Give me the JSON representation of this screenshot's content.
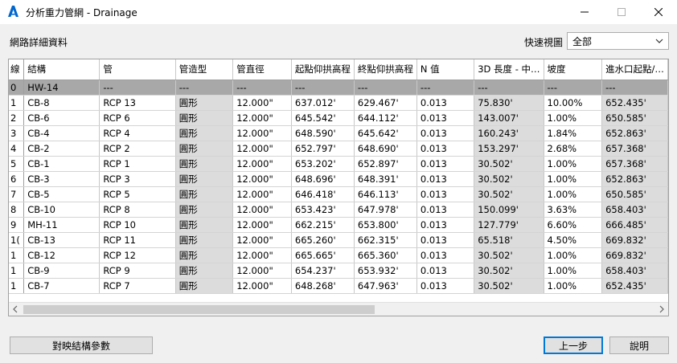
{
  "window": {
    "title": "分析重力管網 - Drainage"
  },
  "section_label": "網路詳細資料",
  "quick_view": {
    "label": "快速視圖",
    "value": "全部"
  },
  "columns": [
    "線",
    "結構",
    "管",
    "管造型",
    "管直徑",
    "起點仰拱高程",
    "終點仰拱高程",
    "N 值",
    "3D 長度 - 中…",
    "坡度",
    "進水口起點/…"
  ],
  "rows": [
    [
      "0",
      "HW-14",
      "---",
      "---",
      "---",
      "---",
      "---",
      "---",
      "---",
      "---",
      "---"
    ],
    [
      "1",
      "CB-8",
      "RCP 13",
      "圓形",
      "12.000\"",
      "637.012'",
      "629.467'",
      "0.013",
      "75.830'",
      "10.00%",
      "652.435'"
    ],
    [
      "2",
      "CB-6",
      "RCP 6",
      "圓形",
      "12.000\"",
      "645.542'",
      "644.112'",
      "0.013",
      "143.007'",
      "1.00%",
      "650.585'"
    ],
    [
      "3",
      "CB-4",
      "RCP 4",
      "圓形",
      "12.000\"",
      "648.590'",
      "645.642'",
      "0.013",
      "160.243'",
      "1.84%",
      "652.863'"
    ],
    [
      "4",
      "CB-2",
      "RCP 2",
      "圓形",
      "12.000\"",
      "652.797'",
      "648.690'",
      "0.013",
      "153.297'",
      "2.68%",
      "657.368'"
    ],
    [
      "5",
      "CB-1",
      "RCP 1",
      "圓形",
      "12.000\"",
      "653.202'",
      "652.897'",
      "0.013",
      "30.502'",
      "1.00%",
      "657.368'"
    ],
    [
      "6",
      "CB-3",
      "RCP 3",
      "圓形",
      "12.000\"",
      "648.696'",
      "648.391'",
      "0.013",
      "30.502'",
      "1.00%",
      "652.863'"
    ],
    [
      "7",
      "CB-5",
      "RCP 5",
      "圓形",
      "12.000\"",
      "646.418'",
      "646.113'",
      "0.013",
      "30.502'",
      "1.00%",
      "650.585'"
    ],
    [
      "8",
      "CB-10",
      "RCP 8",
      "圓形",
      "12.000\"",
      "653.423'",
      "647.978'",
      "0.013",
      "150.099'",
      "3.63%",
      "658.403'"
    ],
    [
      "9",
      "MH-11",
      "RCP 10",
      "圓形",
      "12.000\"",
      "662.215'",
      "653.800'",
      "0.013",
      "127.779'",
      "6.60%",
      "666.485'"
    ],
    [
      "1(",
      "CB-13",
      "RCP 11",
      "圓形",
      "12.000\"",
      "665.260'",
      "662.315'",
      "0.013",
      "65.518'",
      "4.50%",
      "669.832'"
    ],
    [
      "1",
      "CB-12",
      "RCP 12",
      "圓形",
      "12.000\"",
      "665.665'",
      "665.360'",
      "0.013",
      "30.502'",
      "1.00%",
      "669.832'"
    ],
    [
      "1",
      "CB-9",
      "RCP 9",
      "圓形",
      "12.000\"",
      "654.237'",
      "653.932'",
      "0.013",
      "30.502'",
      "1.00%",
      "658.403'"
    ],
    [
      "1",
      "CB-7",
      "RCP 7",
      "圓形",
      "12.000\"",
      "648.268'",
      "647.963'",
      "0.013",
      "30.502'",
      "1.00%",
      "652.435'"
    ]
  ],
  "buttons": {
    "map_params": "對映結構參數",
    "back": "上一步",
    "help": "說明"
  },
  "icons": {
    "app": "autodesk-a-icon",
    "minimize": "minimize-icon",
    "maximize": "maximize-icon",
    "close": "close-icon"
  },
  "colors": {
    "accent": "#0078d7",
    "app_icon": "#0066cc",
    "selected_row": "#a8a8a8",
    "readonly_cell": "#dcdcdc"
  }
}
